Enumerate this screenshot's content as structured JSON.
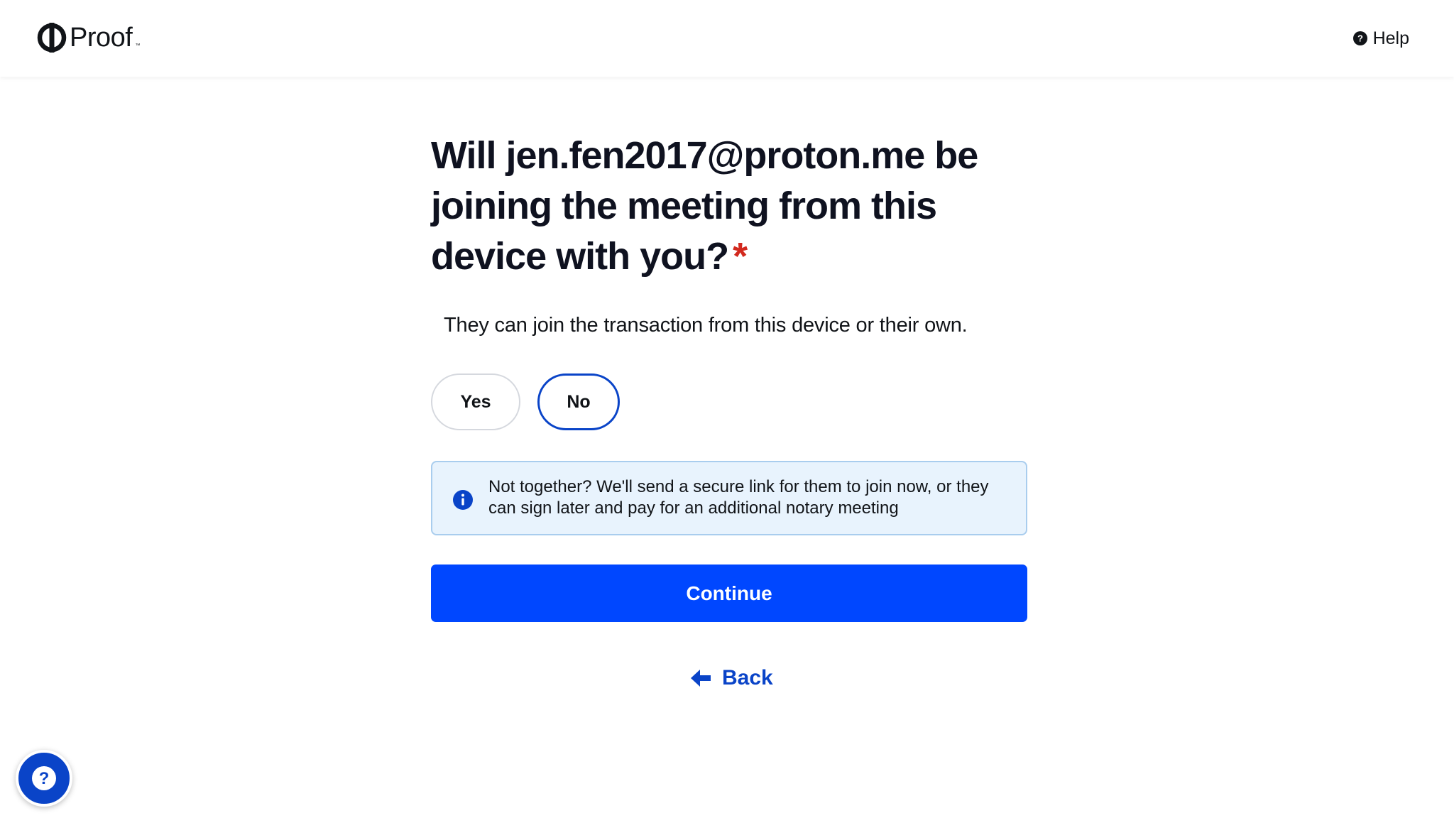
{
  "header": {
    "logo_text": "Proof",
    "logo_tm": "™",
    "help_label": "Help"
  },
  "question": {
    "title": "Will jen.fen2017@proton.me be joining the meeting from this device with you?",
    "required_marker": "*",
    "subtitle": "They can join the transaction from this device or their own."
  },
  "choices": {
    "yes_label": "Yes",
    "no_label": "No",
    "selected": "No"
  },
  "notice": {
    "text": "Not together? We'll send a secure link for them to join now, or they can sign later and pay for an additional notary meeting"
  },
  "actions": {
    "continue_label": "Continue",
    "back_label": "Back"
  },
  "icons": {
    "logo": "proof-logo-icon",
    "help": "question-circle-icon",
    "info": "info-icon",
    "back": "arrow-left-icon",
    "support": "question-circle-icon"
  },
  "colors": {
    "primary": "#0047ff",
    "accent_blue": "#0a44c8",
    "required_red": "#d2291e",
    "notice_bg": "#e8f3fd",
    "notice_border": "#a9cdee"
  }
}
